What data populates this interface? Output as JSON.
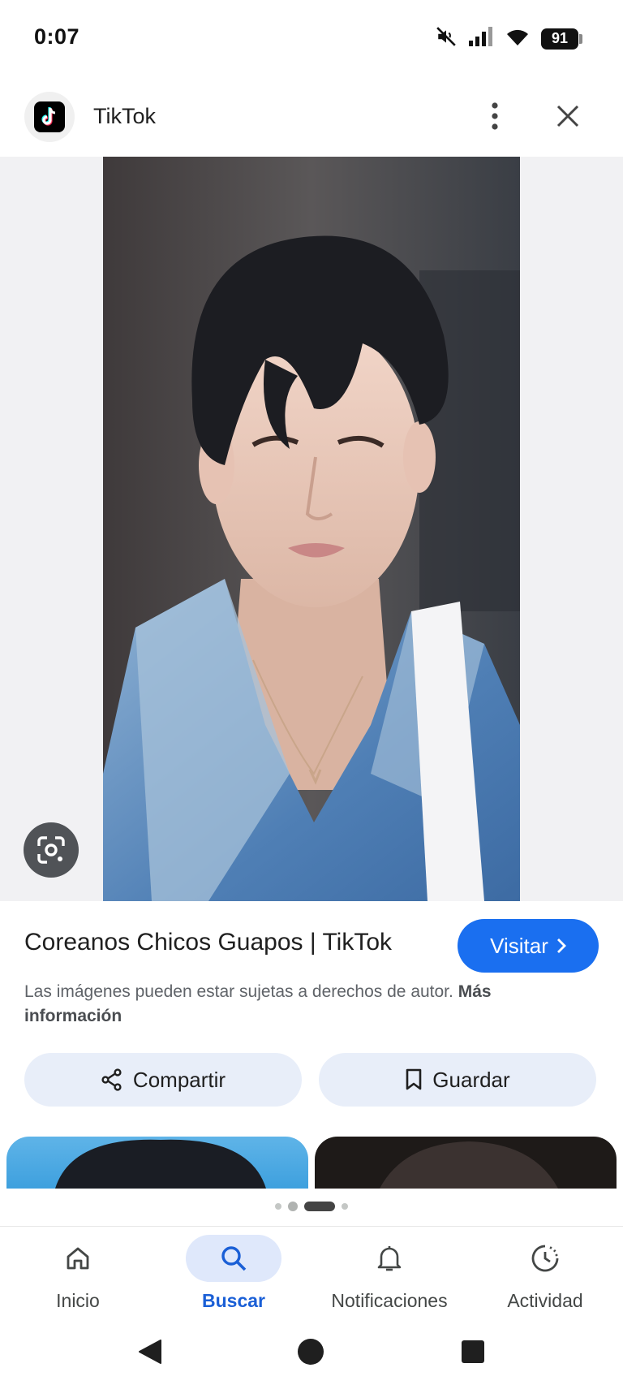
{
  "status_bar": {
    "time": "0:07",
    "battery": "91"
  },
  "header": {
    "source_name": "TikTok"
  },
  "result": {
    "title": "Coreanos Chicos Guapos | TikTok",
    "visit_label": "Visitar",
    "copyright_text": "Las imágenes pueden estar sujetas a derechos de autor.",
    "more_info_label": "Más información"
  },
  "actions": {
    "share_label": "Compartir",
    "save_label": "Guardar"
  },
  "bottom_nav": {
    "items": [
      {
        "label": "Inicio",
        "icon": "home-icon"
      },
      {
        "label": "Buscar",
        "icon": "search-icon",
        "active": true
      },
      {
        "label": "Notificaciones",
        "icon": "bell-icon"
      },
      {
        "label": "Actividad",
        "icon": "activity-icon"
      }
    ]
  },
  "colors": {
    "accent": "#1a6ff0",
    "chip_bg": "#e8eef9",
    "nav_active_bg": "#dfe8fb",
    "nav_active_text": "#1a5fd6"
  }
}
